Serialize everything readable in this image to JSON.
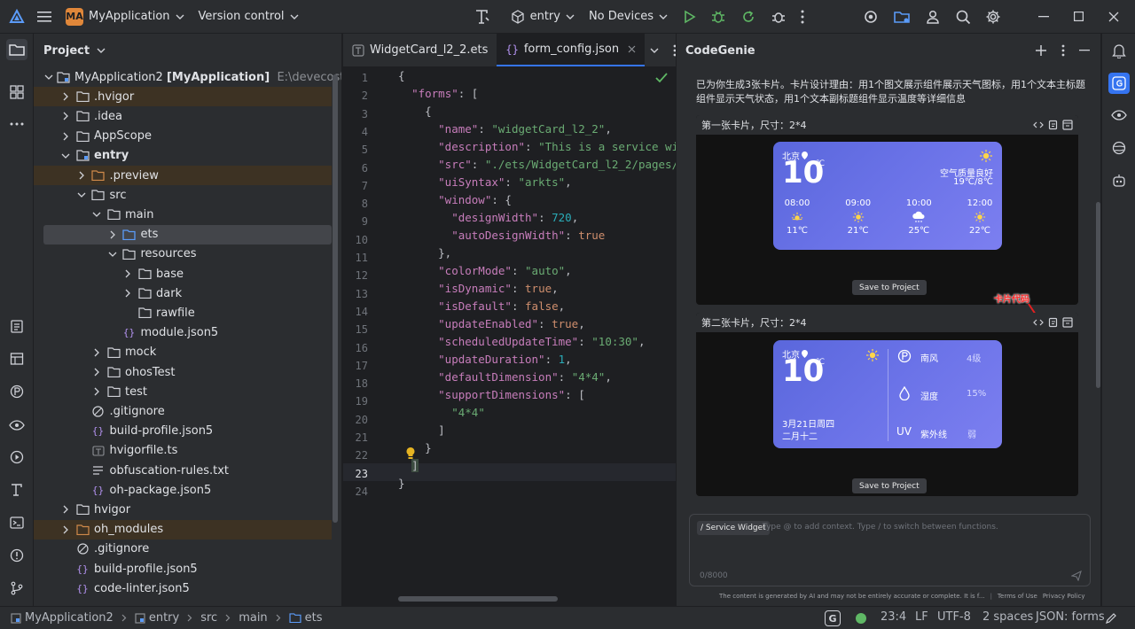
{
  "toolbar": {
    "app_badge": "MA",
    "project_name": "MyApplication",
    "version_control": "Version control",
    "run_config": "entry",
    "device": "No Devices"
  },
  "project_panel": {
    "title": "Project",
    "root_name": "MyApplication2",
    "root_module": "[MyApplication]",
    "root_path": "E:\\devecostudio-wind",
    "items": [
      {
        "label": ".hvigor"
      },
      {
        "label": ".idea"
      },
      {
        "label": "AppScope"
      },
      {
        "label": "entry"
      },
      {
        "label": ".preview"
      },
      {
        "label": "src"
      },
      {
        "label": "main"
      },
      {
        "label": "ets"
      },
      {
        "label": "resources"
      },
      {
        "label": "base"
      },
      {
        "label": "dark"
      },
      {
        "label": "rawfile"
      },
      {
        "label": "module.json5"
      },
      {
        "label": "mock"
      },
      {
        "label": "ohosTest"
      },
      {
        "label": "test"
      },
      {
        "label": ".gitignore"
      },
      {
        "label": "build-profile.json5"
      },
      {
        "label": "hvigorfile.ts"
      },
      {
        "label": "obfuscation-rules.txt"
      },
      {
        "label": "oh-package.json5"
      },
      {
        "label": "hvigor"
      },
      {
        "label": "oh_modules"
      },
      {
        "label": ".gitignore"
      },
      {
        "label": "build-profile.json5"
      },
      {
        "label": "code-linter.json5"
      }
    ]
  },
  "editor": {
    "tabs": [
      {
        "label": "WidgetCard_l2_2.ets"
      },
      {
        "label": "form_config.json"
      }
    ],
    "line_numbers": [
      "1",
      "2",
      "3",
      "4",
      "5",
      "6",
      "7",
      "8",
      "9",
      "10",
      "11",
      "12",
      "13",
      "14",
      "15",
      "16",
      "17",
      "18",
      "19",
      "20",
      "21",
      "22",
      "23",
      "24"
    ]
  },
  "codegenie": {
    "title": "CodeGenie",
    "intro": "已为你生成3张卡片。卡片设计理由：用1个图文展示组件展示天气图标，用1个文本主标题组件显示天气状态，用1个文本副标题组件显示温度等详细信息",
    "card1": {
      "header": "第一张卡片，尺寸：2*4",
      "city": "北京",
      "temp": "10",
      "unit": "℃",
      "aqi": "空气质量良好",
      "range": "19℃/8℃",
      "hours": [
        {
          "time": "08:00",
          "temp": "11℃"
        },
        {
          "time": "09:00",
          "temp": "21℃"
        },
        {
          "time": "10:00",
          "temp": "25℃"
        },
        {
          "time": "12:00",
          "temp": "22℃"
        }
      ],
      "save": "Save to Project"
    },
    "annotation": "卡片代码",
    "card2": {
      "header": "第二张卡片，尺寸：2*4",
      "city": "北京",
      "temp": "10",
      "unit": "℃",
      "date": "3月21日周四",
      "lunar": "二月十二",
      "stats": [
        {
          "label": "南风",
          "value": "4级"
        },
        {
          "label": "湿度",
          "value": "15%"
        },
        {
          "label": "紫外线",
          "value": "弱"
        }
      ],
      "uv": "UV",
      "save": "Save to Project"
    },
    "input": {
      "chip": "/ Service Widget",
      "placeholder": "Type @ to add context. Type / to switch between functions.",
      "counter": "0/8000"
    },
    "footer": {
      "disclaimer": "The content is generated by AI and may not be entirely accurate or complete. It is f...",
      "terms": "Terms of Use",
      "privacy": "Privacy Policy"
    }
  },
  "statusbar": {
    "breadcrumb": [
      "MyApplication2",
      "entry",
      "src",
      "main",
      "ets"
    ],
    "position": "23:4",
    "line_sep": "LF",
    "encoding": "UTF-8",
    "indent": "2 spaces",
    "schema": "JSON: forms",
    "g_badge": "G"
  },
  "colors": {
    "accent": "#3574f0",
    "run_green": "#5fb865",
    "card_gradient": "#6b73e8"
  }
}
